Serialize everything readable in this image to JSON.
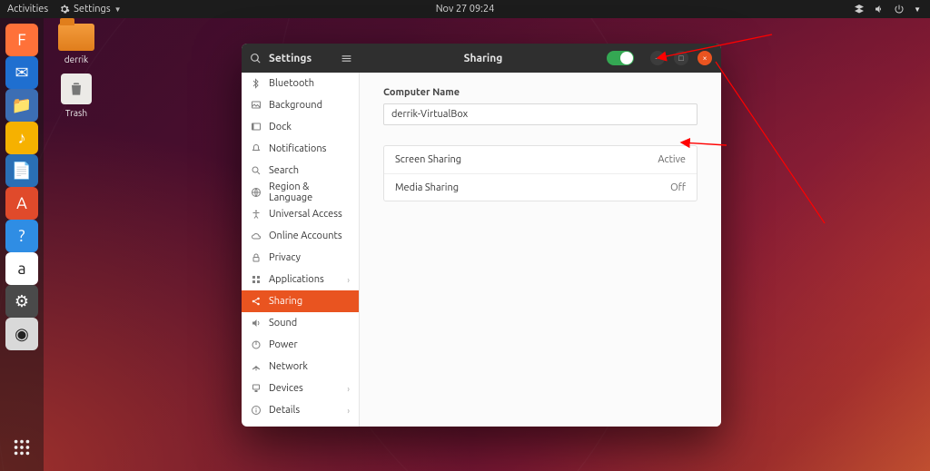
{
  "topbar": {
    "activities": "Activities",
    "appmenu": "Settings",
    "datetime": "Nov 27  09:24"
  },
  "desktop": {
    "folder_label": "derrik",
    "trash_label": "Trash"
  },
  "dock": {
    "items": [
      {
        "name": "firefox",
        "bg": "#ff7139",
        "glyph": "F"
      },
      {
        "name": "thunderbird",
        "bg": "#1f6fd0",
        "glyph": "✉"
      },
      {
        "name": "files",
        "bg": "#3c6eb4",
        "glyph": "📁"
      },
      {
        "name": "rhythmbox",
        "bg": "#f6b100",
        "glyph": "♪"
      },
      {
        "name": "libreoffice",
        "bg": "#2a6fb5",
        "glyph": "📄"
      },
      {
        "name": "software",
        "bg": "#e04a2b",
        "glyph": "A"
      },
      {
        "name": "help",
        "bg": "#2f8de4",
        "glyph": "?"
      },
      {
        "name": "amazon",
        "bg": "#ffffff",
        "glyph": "a"
      },
      {
        "name": "settings",
        "bg": "#4a4a4a",
        "glyph": "⚙"
      },
      {
        "name": "disc",
        "bg": "#d9d9d9",
        "glyph": "◉"
      }
    ]
  },
  "window": {
    "sidebar_title": "Settings",
    "header_title": "Sharing",
    "toggle_on": true,
    "items": [
      {
        "id": "bluetooth",
        "label": "Bluetooth",
        "icon": "bt"
      },
      {
        "id": "background",
        "label": "Background",
        "icon": "bg"
      },
      {
        "id": "dock",
        "label": "Dock",
        "icon": "dock"
      },
      {
        "id": "notifications",
        "label": "Notifications",
        "icon": "bell"
      },
      {
        "id": "search",
        "label": "Search",
        "icon": "search"
      },
      {
        "id": "region",
        "label": "Region & Language",
        "icon": "globe"
      },
      {
        "id": "access",
        "label": "Universal Access",
        "icon": "ua"
      },
      {
        "id": "online",
        "label": "Online Accounts",
        "icon": "cloud"
      },
      {
        "id": "privacy",
        "label": "Privacy",
        "icon": "lock"
      },
      {
        "id": "apps",
        "label": "Applications",
        "icon": "apps",
        "chev": true
      },
      {
        "id": "sharing",
        "label": "Sharing",
        "icon": "share",
        "active": true
      },
      {
        "id": "sound",
        "label": "Sound",
        "icon": "sound"
      },
      {
        "id": "power",
        "label": "Power",
        "icon": "power"
      },
      {
        "id": "network",
        "label": "Network",
        "icon": "net"
      },
      {
        "id": "devices",
        "label": "Devices",
        "icon": "dev",
        "chev": true
      },
      {
        "id": "details",
        "label": "Details",
        "icon": "info",
        "chev": true
      }
    ],
    "content": {
      "computer_name_label": "Computer Name",
      "computer_name_value": "derrik-VirtualBox",
      "rows": [
        {
          "label": "Screen Sharing",
          "status": "Active"
        },
        {
          "label": "Media Sharing",
          "status": "Off"
        }
      ]
    }
  }
}
